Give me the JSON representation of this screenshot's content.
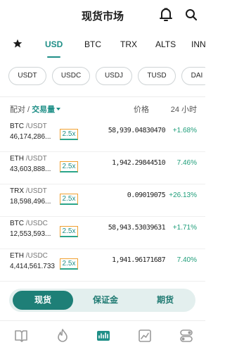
{
  "header": {
    "title": "现货市场",
    "icons": [
      "bell-icon",
      "search-icon"
    ]
  },
  "quote_tabs": [
    {
      "label": "USD",
      "active": true
    },
    {
      "label": "BTC",
      "active": false
    },
    {
      "label": "TRX",
      "active": false
    },
    {
      "label": "ALTS",
      "active": false
    },
    {
      "label": "INN",
      "active": false
    }
  ],
  "stable_filters": [
    "USDT",
    "USDC",
    "USDJ",
    "TUSD",
    "DAI"
  ],
  "columns": {
    "pair": "配对 /",
    "volume": "交易量",
    "price": "价格",
    "change": "24 小时"
  },
  "rows": [
    {
      "base": "BTC",
      "quote": "/USDT",
      "volume": "46,174,286...",
      "leverage": "2.5x",
      "price": "58,939.04830470",
      "change": "+1.68%"
    },
    {
      "base": "ETH",
      "quote": "/USDT",
      "volume": "43,603,888...",
      "leverage": "2.5x",
      "price": "1,942.29844510",
      "change": "7.46%"
    },
    {
      "base": "TRX",
      "quote": "/USDT",
      "volume": "18,598,496...",
      "leverage": "2.5x",
      "price": "0.09019075",
      "change": "+26.13%"
    },
    {
      "base": "BTC",
      "quote": "/USDC",
      "volume": "12,553,593...",
      "leverage": "2.5x",
      "price": "58,943.53039631",
      "change": "+1.71%"
    },
    {
      "base": "ETH",
      "quote": "/USDC",
      "volume": "4,414,561.733",
      "leverage": "2.5x",
      "price": "1,941.96171687",
      "change": "7.40%"
    }
  ],
  "market_type": [
    {
      "label": "现货",
      "active": true
    },
    {
      "label": "保证金",
      "active": false
    },
    {
      "label": "期货",
      "active": false
    }
  ],
  "bottom_nav": [
    "book-icon",
    "flame-icon",
    "market-chart-icon",
    "trend-chart-icon",
    "toggle-settings-icon"
  ],
  "colors": {
    "accent": "#1f8f87",
    "positive": "#1f9e7a",
    "leverage_border": "#f0a030"
  }
}
